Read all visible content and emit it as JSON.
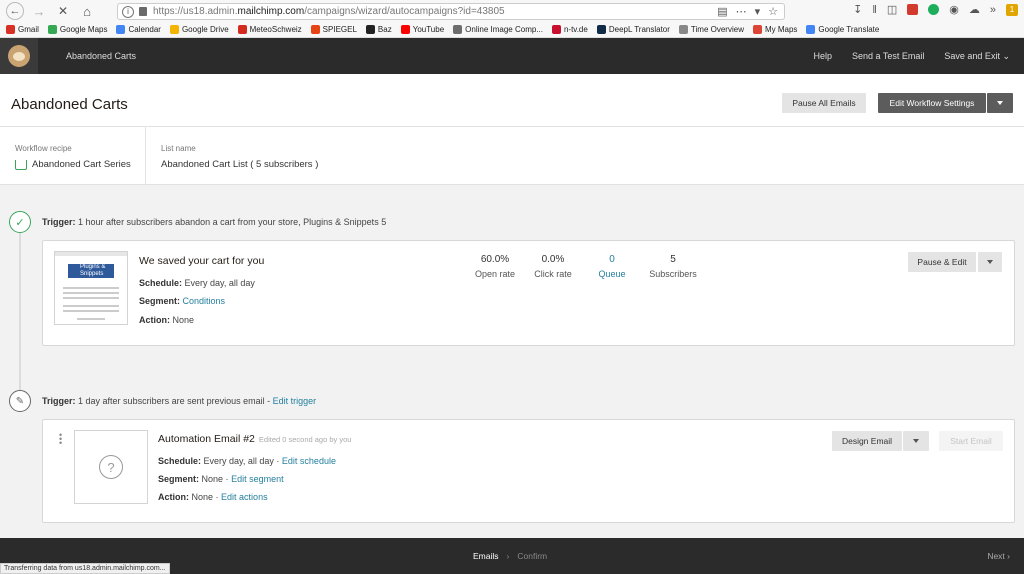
{
  "browser": {
    "url_prefix": "https://us18.admin.",
    "url_domain": "mailchimp.com",
    "url_suffix": "/campaigns/wizard/autocampaigns?id=43805",
    "bookmarks": [
      {
        "label": "Gmail",
        "color": "#d93025"
      },
      {
        "label": "Google Maps",
        "color": "#34a853"
      },
      {
        "label": "Calendar",
        "color": "#4285f4"
      },
      {
        "label": "Google Drive",
        "color": "#f4b400"
      },
      {
        "label": "MeteoSchweiz",
        "color": "#d52b1e"
      },
      {
        "label": "SPIEGEL",
        "color": "#e64415"
      },
      {
        "label": "Baz",
        "color": "#222222"
      },
      {
        "label": "YouTube",
        "color": "#ff0000"
      },
      {
        "label": "Online Image Comp...",
        "color": "#6d6d6d"
      },
      {
        "label": "n-tv.de",
        "color": "#c8102e"
      },
      {
        "label": "DeepL Translator",
        "color": "#0f2b46"
      },
      {
        "label": "Time Overview",
        "color": "#888888"
      },
      {
        "label": "My Maps",
        "color": "#db4437"
      },
      {
        "label": "Google Translate",
        "color": "#4285f4"
      }
    ],
    "status_tip": "Transferring data from us18.admin.mailchimp.com..."
  },
  "header": {
    "title": "Abandoned Carts",
    "links": [
      "Help",
      "Send a Test Email",
      "Save and Exit"
    ]
  },
  "page": {
    "title": "Abandoned Carts",
    "pause_all": "Pause All Emails",
    "edit_settings": "Edit Workflow Settings"
  },
  "recipe": {
    "workflow_label": "Workflow recipe",
    "workflow_value": "Abandoned Cart Series",
    "list_label": "List name",
    "list_value": "Abandoned Cart List ( 5 subscribers )"
  },
  "trigger1": {
    "label": "Trigger:",
    "text": "1 hour after subscribers abandon a cart from your store, Plugins & Snippets 5"
  },
  "email1": {
    "title": "We saved your cart for you",
    "schedule_label": "Schedule:",
    "schedule_value": "Every day, all day",
    "segment_label": "Segment:",
    "segment_value": "Conditions",
    "action_label": "Action:",
    "action_value": "None",
    "thumb_logo": "Plugins & Snippets",
    "stats": [
      {
        "value": "60.0%",
        "label": "Open rate"
      },
      {
        "value": "0.0%",
        "label": "Click rate"
      },
      {
        "value": "0",
        "label": "Queue"
      },
      {
        "value": "5",
        "label": "Subscribers"
      }
    ],
    "pause_edit": "Pause & Edit"
  },
  "trigger2": {
    "label": "Trigger:",
    "text": "1 day after subscribers are sent previous email -",
    "link": "Edit trigger"
  },
  "email2": {
    "title": "Automation Email #2",
    "edited": "Edited 0 second ago by you",
    "schedule_label": "Schedule:",
    "schedule_value": "Every day, all day ·",
    "schedule_link": "Edit schedule",
    "segment_label": "Segment:",
    "segment_value": "None ·",
    "segment_link": "Edit segment",
    "action_label": "Action:",
    "action_value": "None ·",
    "action_link": "Edit actions",
    "design": "Design Email",
    "start": "Start Email"
  },
  "footer": {
    "step1": "Emails",
    "step2": "Confirm",
    "next": "Next"
  },
  "colors": {
    "header_bg": "#2b2b2b",
    "link": "#247f9e",
    "success": "#3ba55c"
  }
}
